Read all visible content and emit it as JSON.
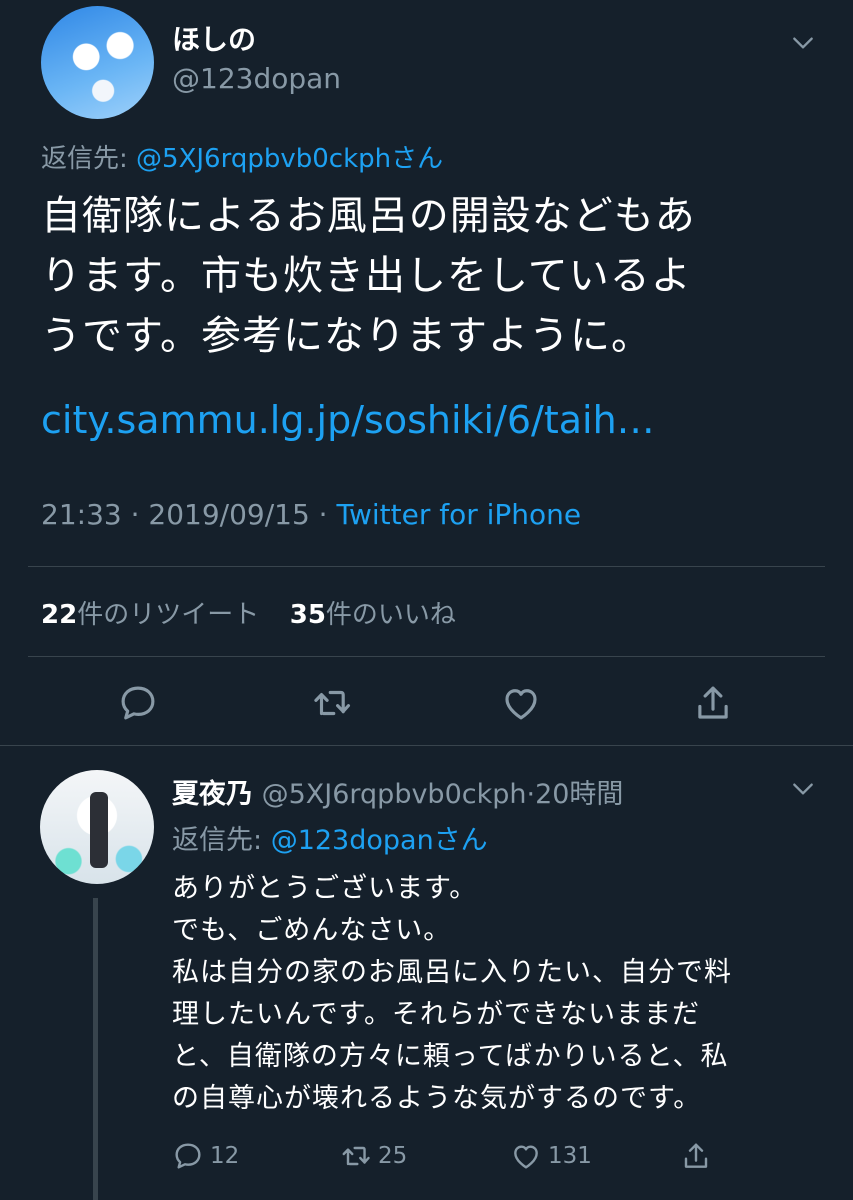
{
  "main_tweet": {
    "author_name": "ほしの",
    "handle": "@123dopan",
    "reply_prefix": "返信先: ",
    "reply_to": "@5XJ6rqpbvb0ckphさん",
    "lines": [
      "自衛隊によるお風呂の開設などもあ",
      "ります。市も炊き出しをしているよ",
      "うです。参考になりますように。"
    ],
    "link": "city.sammu.lg.jp/soshiki/6/taih…",
    "time": "21:33 · 2019/09/15 · ",
    "source": "Twitter for iPhone",
    "retweet_count": "22",
    "retweet_label": "件のリツイート",
    "like_count": "35",
    "like_label": "件のいいね"
  },
  "reply_tweet": {
    "author_name": "夏夜乃",
    "handle": "@5XJ6rqpbvb0ckph",
    "time": "·20時間",
    "reply_prefix": "返信先: ",
    "reply_to": "@123dopanさん",
    "lines": [
      "ありがとうございます。",
      "でも、ごめんなさい。",
      "私は自分の家のお風呂に入りたい、自分で料",
      "理したいんです。それらができないままだ",
      "と、自衛隊の方々に頼ってばかりいると、私",
      "の自尊心が壊れるような気がするのです。"
    ],
    "reply_count": "12",
    "retweet_count": "25",
    "like_count": "131"
  },
  "colors": {
    "background": "#15202b",
    "text": "#ffffff",
    "muted": "#8899a6",
    "link": "#1da1f2",
    "divider": "#38444d"
  },
  "icons": [
    "chevron-down-icon",
    "reply-icon",
    "retweet-icon",
    "like-icon",
    "share-icon"
  ]
}
